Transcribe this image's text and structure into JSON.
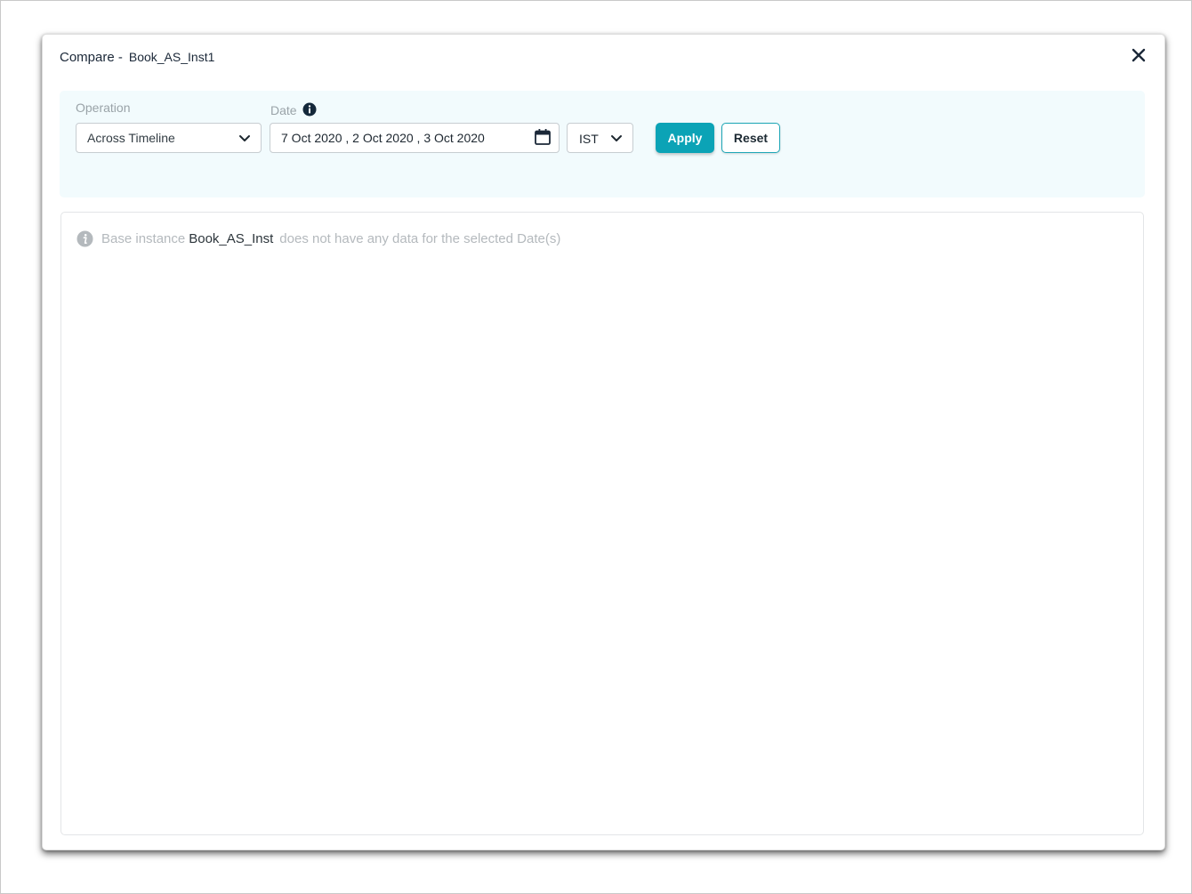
{
  "modal": {
    "title_prefix": "Compare -",
    "title_name": "Book_AS_Inst1",
    "close_icon": "close-icon"
  },
  "filters": {
    "operation": {
      "label": "Operation",
      "value": "Across Timeline",
      "icon": "chevron-down-icon"
    },
    "date": {
      "label": "Date",
      "info_icon": "info-icon",
      "value": "7 Oct 2020 ,  2 Oct 2020 ,  3 Oct 2020",
      "icon": "calendar-icon"
    },
    "timezone": {
      "value": "IST",
      "icon": "chevron-down-icon"
    },
    "apply_label": "Apply",
    "reset_label": "Reset"
  },
  "message": {
    "icon": "info-icon",
    "prefix": "Base instance",
    "instance": "Book_AS_Inst",
    "suffix": "does not have any data for the selected Date(s)"
  },
  "colors": {
    "accent": "#0ba3b6",
    "panel_background": "#f2fbfd",
    "title_text": "#1b2838"
  }
}
